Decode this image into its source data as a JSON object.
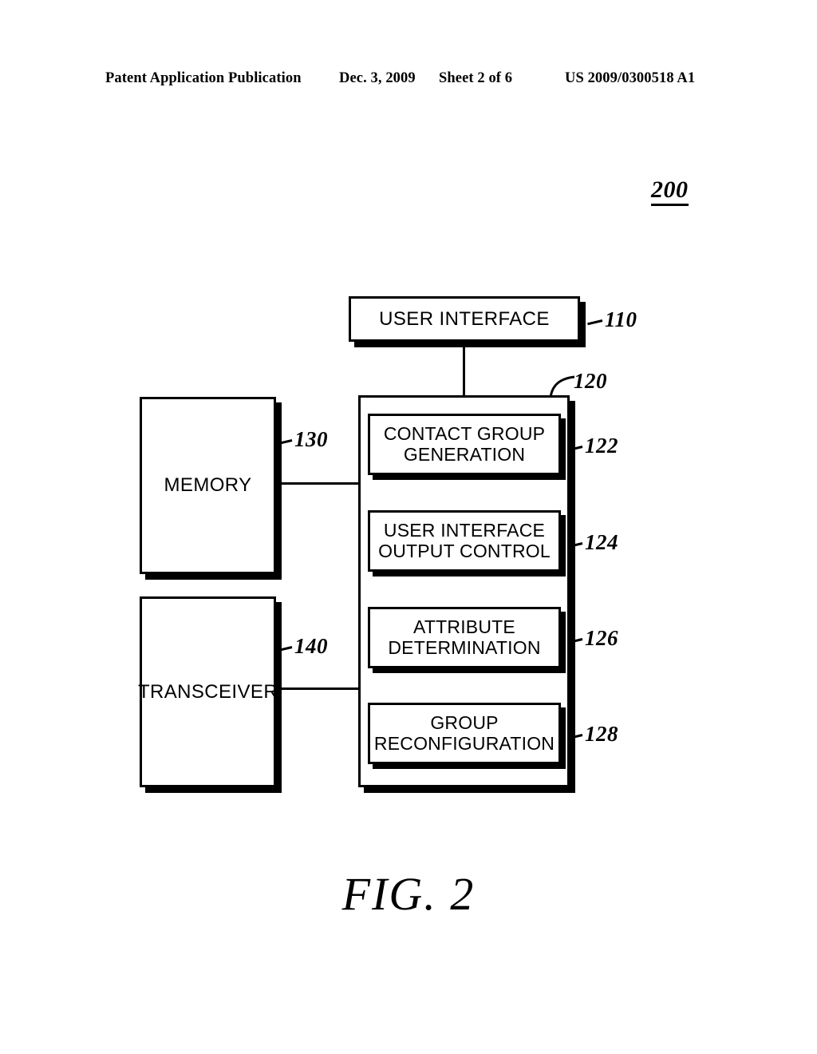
{
  "header": {
    "publication": "Patent Application Publication",
    "date": "Dec. 3, 2009",
    "sheet": "Sheet 2 of 6",
    "publication_number": "US 2009/0300518 A1"
  },
  "figure": {
    "system_reference": "200",
    "caption": "FIG. 2"
  },
  "diagram": {
    "type": "block-diagram",
    "blocks": {
      "user_interface": {
        "label": "USER INTERFACE",
        "ref": "110"
      },
      "memory": {
        "label": "MEMORY",
        "ref": "130"
      },
      "transceiver": {
        "label": "TRANSCEIVER",
        "ref": "140"
      },
      "processor": {
        "label": "",
        "ref": "120"
      }
    },
    "modules": [
      {
        "label": "CONTACT GROUP\nGENERATION",
        "line1": "CONTACT GROUP",
        "line2": "GENERATION",
        "ref": "122"
      },
      {
        "label": "USER INTERFACE\nOUTPUT CONTROL",
        "line1": "USER INTERFACE",
        "line2": "OUTPUT CONTROL",
        "ref": "124"
      },
      {
        "label": "ATTRIBUTE\nDETERMINATION",
        "line1": "ATTRIBUTE",
        "line2": "DETERMINATION",
        "ref": "126"
      },
      {
        "label": "GROUP\nRECONFIGURATION",
        "line1": "GROUP",
        "line2": "RECONFIGURATION",
        "ref": "128"
      }
    ],
    "connections": [
      {
        "from": "user_interface",
        "to": "processor"
      },
      {
        "from": "memory",
        "to": "processor"
      },
      {
        "from": "transceiver",
        "to": "processor"
      }
    ]
  },
  "colors": {
    "ink": "#000000",
    "paper": "#ffffff"
  }
}
